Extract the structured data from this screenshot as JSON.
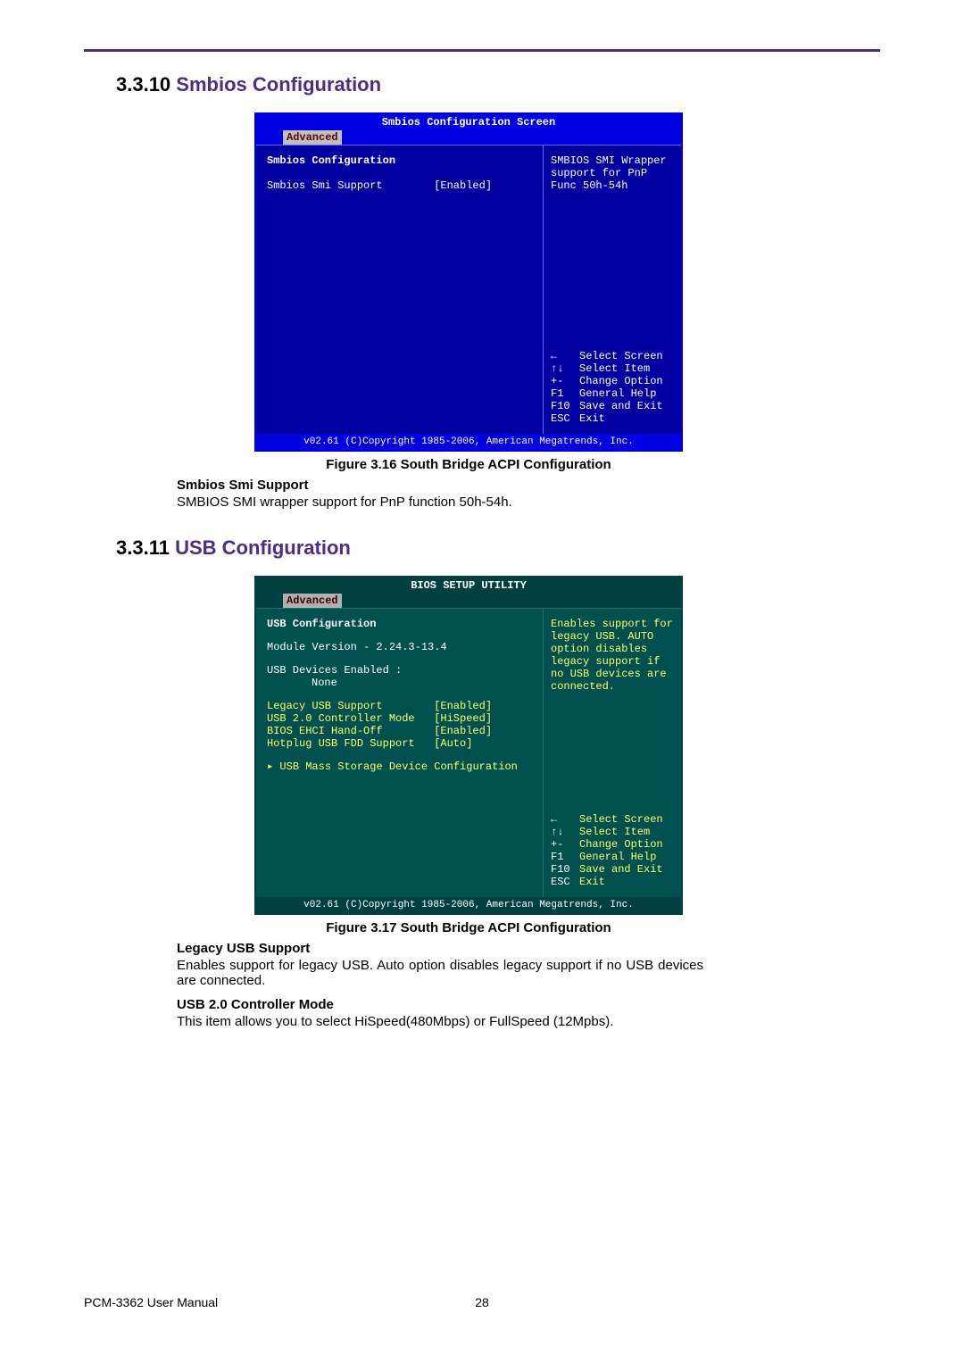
{
  "section1": {
    "number": "3.3.10",
    "title": "Smbios Configuration",
    "bios": {
      "title": "Smbios Configuration Screen",
      "tab": "Advanced",
      "heading": "Smbios Configuration",
      "item_label": "Smbios Smi Support",
      "item_value": "[Enabled]",
      "help": "SMBIOS SMI Wrapper support for PnP Func 50h-54h",
      "keys": [
        {
          "sym": "←",
          "text": "Select Screen"
        },
        {
          "sym": "↑↓",
          "text": "Select Item"
        },
        {
          "sym": "+-",
          "text": "Change Option"
        },
        {
          "sym": "F1",
          "text": "General Help"
        },
        {
          "sym": "F10",
          "text": "Save and Exit"
        },
        {
          "sym": "ESC",
          "text": "Exit"
        }
      ],
      "footer": "v02.61 (C)Copyright 1985-2006, American Megatrends, Inc."
    },
    "caption": "Figure 3.16 South Bridge ACPI Configuration",
    "sub_heading": "Smbios Smi Support",
    "sub_text": "SMBIOS SMI wrapper support for PnP function 50h-54h."
  },
  "section2": {
    "number": "3.3.11",
    "title": "USB Configuration",
    "bios": {
      "title": "BIOS SETUP UTILITY",
      "tab": "Advanced",
      "heading": "USB Configuration",
      "module": "Module Version - 2.24.3-13.4",
      "devices_label": "USB Devices Enabled :",
      "devices_value": "None",
      "items": [
        {
          "label": "Legacy USB Support",
          "value": "[Enabled]"
        },
        {
          "label": "USB 2.0 Controller Mode",
          "value": "[HiSpeed]"
        },
        {
          "label": "BIOS EHCI Hand-Off",
          "value": "[Enabled]"
        },
        {
          "label": "Hotplug USB FDD Support",
          "value": "[Auto]"
        }
      ],
      "submenu": "▸ USB Mass Storage Device Configuration",
      "help": "Enables support for legacy USB. AUTO option disables legacy support if no USB devices are connected.",
      "keys": [
        {
          "sym": "←",
          "text": "Select Screen"
        },
        {
          "sym": "↑↓",
          "text": "Select Item"
        },
        {
          "sym": "+-",
          "text": "Change Option"
        },
        {
          "sym": "F1",
          "text": "General Help"
        },
        {
          "sym": "F10",
          "text": "Save and Exit"
        },
        {
          "sym": "ESC",
          "text": "Exit"
        }
      ],
      "footer": "v02.61 (C)Copyright 1985-2006, American Megatrends, Inc."
    },
    "caption": "Figure 3.17 South Bridge ACPI Configuration",
    "sub1_heading": "Legacy USB Support",
    "sub1_text": "Enables support for legacy USB. Auto option disables legacy support if no USB devices are connected.",
    "sub2_heading": "USB 2.0 Controller Mode",
    "sub2_text": "This item allows you to select HiSpeed(480Mbps) or FullSpeed (12Mpbs)."
  },
  "footer": {
    "left": "PCM-3362 User Manual",
    "page": "28"
  }
}
